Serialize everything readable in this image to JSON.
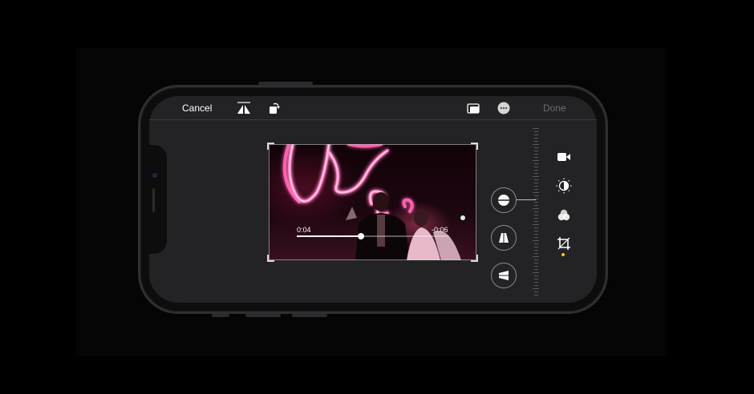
{
  "toolbar": {
    "cancel_label": "Cancel",
    "done_label": "Done",
    "icons": [
      "flip-icon",
      "rotate-icon",
      "aspect-ratio-icon",
      "more-icon"
    ]
  },
  "video": {
    "current_time": "0:04",
    "remaining_time": "-0:06",
    "progress": 0.42
  },
  "adjust_controls": [
    "straighten-icon",
    "vertical-perspective-icon",
    "horizontal-perspective-icon"
  ],
  "edit_tools": [
    "video-icon",
    "adjust-icon",
    "filters-icon",
    "crop-icon"
  ],
  "active_tool": "crop-icon",
  "colors": {
    "accent": "#f5c518",
    "text_primary": "#ffffff",
    "text_disabled": "#6b6b6f"
  }
}
